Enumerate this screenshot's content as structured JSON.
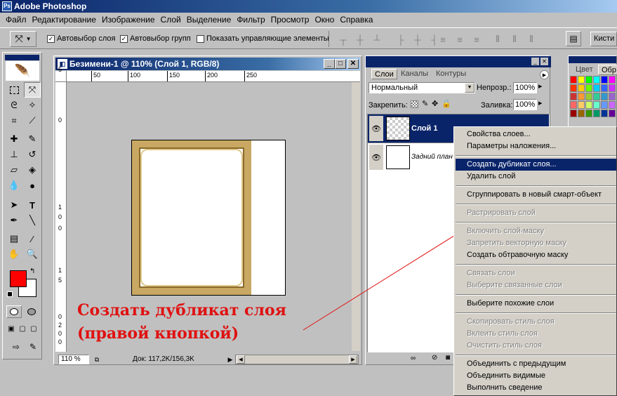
{
  "app": {
    "title": "Adobe Photoshop"
  },
  "menu": [
    "Файл",
    "Редактирование",
    "Изображение",
    "Слой",
    "Выделение",
    "Фильтр",
    "Просмотр",
    "Окно",
    "Справка"
  ],
  "options": {
    "auto_select_layer": "Автовыбор слоя",
    "auto_select_group": "Автовыбор групп",
    "show_controls": "Показать управляющие элементы",
    "brushes_tab": "Кисти"
  },
  "document": {
    "title": "Безимени-1 @ 110% (Слой 1, RGB/8)",
    "ruler_top": [
      "50",
      "100",
      "150",
      "200",
      "250"
    ],
    "ruler_left": [
      "5",
      "0",
      "1",
      "0",
      "0",
      "1",
      "5",
      "0",
      "2",
      "0",
      "0"
    ],
    "zoom": "110 %",
    "doc_info": "Док: 117,2K/156,3K"
  },
  "layers_panel": {
    "tabs": [
      "Слои",
      "Каналы",
      "Контуры"
    ],
    "blend_mode": "Нормальный",
    "opacity_label": "Непрозр.:",
    "opacity": "100%",
    "lock_label": "Закрепить:",
    "fill_label": "Заливка:",
    "fill": "100%",
    "layers": [
      {
        "name": "Слой 1",
        "selected": true
      },
      {
        "name": "Задний план",
        "selected": false
      }
    ]
  },
  "color_panel": {
    "tabs": [
      "Цвет",
      "Обр"
    ],
    "swatches": [
      "#ff0000",
      "#ffff00",
      "#00ff00",
      "#00ffff",
      "#0000ff",
      "#ff00ff",
      "#ff3300",
      "#ffcc00",
      "#66ff00",
      "#00ccff",
      "#3366ff",
      "#cc33ff",
      "#cc3333",
      "#ff9933",
      "#99cc33",
      "#33cc99",
      "#3399cc",
      "#9966cc",
      "#ff6666",
      "#ffcc66",
      "#ccff66",
      "#66ffcc",
      "#6699ff",
      "#cc66ff",
      "#990000",
      "#996600",
      "#339900",
      "#009966",
      "#003399",
      "#660099"
    ]
  },
  "context_menu": [
    {
      "label": "Свойства слоев...",
      "disabled": false
    },
    {
      "label": "Параметры наложения...",
      "disabled": false
    },
    {
      "sep": true
    },
    {
      "label": "Создать дубликат слоя...",
      "disabled": false,
      "highlighted": true
    },
    {
      "label": "Удалить слой",
      "disabled": false
    },
    {
      "sep": true
    },
    {
      "label": "Сгруппировать в новый смарт-объект",
      "disabled": false
    },
    {
      "sep": true
    },
    {
      "label": "Растрировать слой",
      "disabled": true
    },
    {
      "sep": true
    },
    {
      "label": "Включить слой-маску",
      "disabled": true
    },
    {
      "label": "Запретить векторную маску",
      "disabled": true
    },
    {
      "label": "Создать обтравочную маску",
      "disabled": false
    },
    {
      "sep": true
    },
    {
      "label": "Связать слои",
      "disabled": true
    },
    {
      "label": "Выберите связанные слои",
      "disabled": true
    },
    {
      "sep": true
    },
    {
      "label": "Выберите похожие слои",
      "disabled": false
    },
    {
      "sep": true
    },
    {
      "label": "Скопировать стиль слоя",
      "disabled": true
    },
    {
      "label": "Вклеить стиль слоя",
      "disabled": true
    },
    {
      "label": "Очистить стиль слоя",
      "disabled": true
    },
    {
      "sep": true
    },
    {
      "label": "Объединить с предыдущим",
      "disabled": false
    },
    {
      "label": "Объединить видимые",
      "disabled": false
    },
    {
      "label": "Выполнить сведение",
      "disabled": false
    }
  ],
  "annotation": {
    "line1": "Создать дубликат слоя",
    "line2": "(правой кнопкой)",
    "color": "#e01010"
  }
}
